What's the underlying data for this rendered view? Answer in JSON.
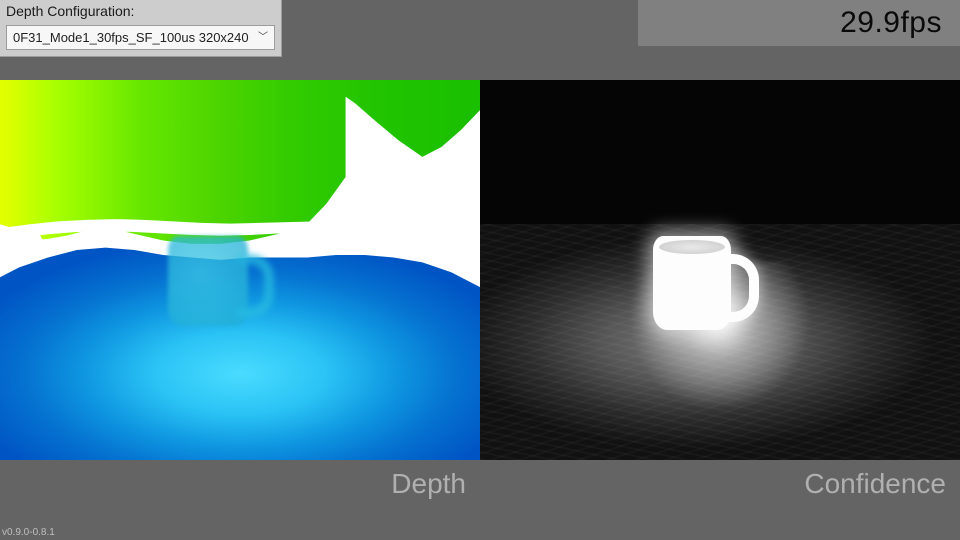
{
  "config": {
    "title": "Depth Configuration:",
    "selected_mode": "0F31_Mode1_30fps_SF_100us 320x240"
  },
  "fps": {
    "value": "29.9fps"
  },
  "views": {
    "left_label": "Depth",
    "right_label": "Confidence"
  },
  "version": "v0.9.0-0.8.1"
}
